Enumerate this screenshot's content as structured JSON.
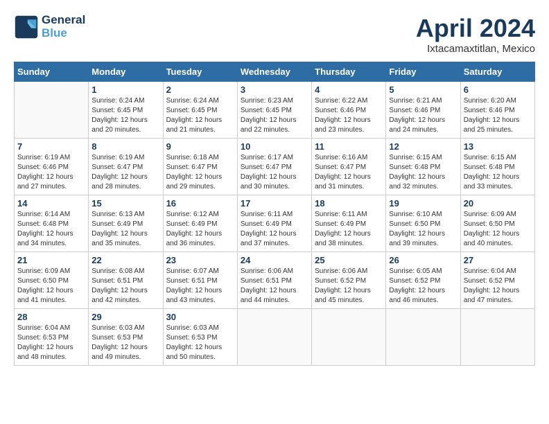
{
  "header": {
    "logo_line1": "General",
    "logo_line2": "Blue",
    "month_year": "April 2024",
    "location": "Ixtacamaxtitlan, Mexico"
  },
  "weekdays": [
    "Sunday",
    "Monday",
    "Tuesday",
    "Wednesday",
    "Thursday",
    "Friday",
    "Saturday"
  ],
  "weeks": [
    [
      {
        "day": "",
        "sunrise": "",
        "sunset": "",
        "daylight": ""
      },
      {
        "day": "1",
        "sunrise": "6:24 AM",
        "sunset": "6:45 PM",
        "daylight": "12 hours and 20 minutes."
      },
      {
        "day": "2",
        "sunrise": "6:24 AM",
        "sunset": "6:45 PM",
        "daylight": "12 hours and 21 minutes."
      },
      {
        "day": "3",
        "sunrise": "6:23 AM",
        "sunset": "6:45 PM",
        "daylight": "12 hours and 22 minutes."
      },
      {
        "day": "4",
        "sunrise": "6:22 AM",
        "sunset": "6:46 PM",
        "daylight": "12 hours and 23 minutes."
      },
      {
        "day": "5",
        "sunrise": "6:21 AM",
        "sunset": "6:46 PM",
        "daylight": "12 hours and 24 minutes."
      },
      {
        "day": "6",
        "sunrise": "6:20 AM",
        "sunset": "6:46 PM",
        "daylight": "12 hours and 25 minutes."
      }
    ],
    [
      {
        "day": "7",
        "sunrise": "6:19 AM",
        "sunset": "6:46 PM",
        "daylight": "12 hours and 27 minutes."
      },
      {
        "day": "8",
        "sunrise": "6:19 AM",
        "sunset": "6:47 PM",
        "daylight": "12 hours and 28 minutes."
      },
      {
        "day": "9",
        "sunrise": "6:18 AM",
        "sunset": "6:47 PM",
        "daylight": "12 hours and 29 minutes."
      },
      {
        "day": "10",
        "sunrise": "6:17 AM",
        "sunset": "6:47 PM",
        "daylight": "12 hours and 30 minutes."
      },
      {
        "day": "11",
        "sunrise": "6:16 AM",
        "sunset": "6:47 PM",
        "daylight": "12 hours and 31 minutes."
      },
      {
        "day": "12",
        "sunrise": "6:15 AM",
        "sunset": "6:48 PM",
        "daylight": "12 hours and 32 minutes."
      },
      {
        "day": "13",
        "sunrise": "6:15 AM",
        "sunset": "6:48 PM",
        "daylight": "12 hours and 33 minutes."
      }
    ],
    [
      {
        "day": "14",
        "sunrise": "6:14 AM",
        "sunset": "6:48 PM",
        "daylight": "12 hours and 34 minutes."
      },
      {
        "day": "15",
        "sunrise": "6:13 AM",
        "sunset": "6:49 PM",
        "daylight": "12 hours and 35 minutes."
      },
      {
        "day": "16",
        "sunrise": "6:12 AM",
        "sunset": "6:49 PM",
        "daylight": "12 hours and 36 minutes."
      },
      {
        "day": "17",
        "sunrise": "6:11 AM",
        "sunset": "6:49 PM",
        "daylight": "12 hours and 37 minutes."
      },
      {
        "day": "18",
        "sunrise": "6:11 AM",
        "sunset": "6:49 PM",
        "daylight": "12 hours and 38 minutes."
      },
      {
        "day": "19",
        "sunrise": "6:10 AM",
        "sunset": "6:50 PM",
        "daylight": "12 hours and 39 minutes."
      },
      {
        "day": "20",
        "sunrise": "6:09 AM",
        "sunset": "6:50 PM",
        "daylight": "12 hours and 40 minutes."
      }
    ],
    [
      {
        "day": "21",
        "sunrise": "6:09 AM",
        "sunset": "6:50 PM",
        "daylight": "12 hours and 41 minutes."
      },
      {
        "day": "22",
        "sunrise": "6:08 AM",
        "sunset": "6:51 PM",
        "daylight": "12 hours and 42 minutes."
      },
      {
        "day": "23",
        "sunrise": "6:07 AM",
        "sunset": "6:51 PM",
        "daylight": "12 hours and 43 minutes."
      },
      {
        "day": "24",
        "sunrise": "6:06 AM",
        "sunset": "6:51 PM",
        "daylight": "12 hours and 44 minutes."
      },
      {
        "day": "25",
        "sunrise": "6:06 AM",
        "sunset": "6:52 PM",
        "daylight": "12 hours and 45 minutes."
      },
      {
        "day": "26",
        "sunrise": "6:05 AM",
        "sunset": "6:52 PM",
        "daylight": "12 hours and 46 minutes."
      },
      {
        "day": "27",
        "sunrise": "6:04 AM",
        "sunset": "6:52 PM",
        "daylight": "12 hours and 47 minutes."
      }
    ],
    [
      {
        "day": "28",
        "sunrise": "6:04 AM",
        "sunset": "6:53 PM",
        "daylight": "12 hours and 48 minutes."
      },
      {
        "day": "29",
        "sunrise": "6:03 AM",
        "sunset": "6:53 PM",
        "daylight": "12 hours and 49 minutes."
      },
      {
        "day": "30",
        "sunrise": "6:03 AM",
        "sunset": "6:53 PM",
        "daylight": "12 hours and 50 minutes."
      },
      {
        "day": "",
        "sunrise": "",
        "sunset": "",
        "daylight": ""
      },
      {
        "day": "",
        "sunrise": "",
        "sunset": "",
        "daylight": ""
      },
      {
        "day": "",
        "sunrise": "",
        "sunset": "",
        "daylight": ""
      },
      {
        "day": "",
        "sunrise": "",
        "sunset": "",
        "daylight": ""
      }
    ]
  ],
  "labels": {
    "sunrise": "Sunrise:",
    "sunset": "Sunset:",
    "daylight": "Daylight:"
  }
}
